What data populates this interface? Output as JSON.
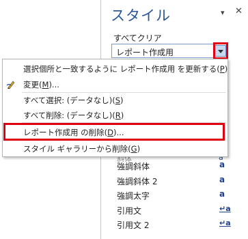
{
  "pane": {
    "title": "スタイル",
    "options_glyph": "▾",
    "close_glyph": "✕",
    "clear_all": "すべてクリア",
    "style_box_value": "レポート作成用"
  },
  "context_menu": {
    "items": [
      {
        "label": "選択個所と一致するように レポート作成用 を更新する(",
        "key": "P",
        "suffix": ")"
      },
      {
        "label": "変更(",
        "key": "M",
        "suffix": ")..."
      },
      {
        "label": "すべて選択: (データなし)(",
        "key": "S",
        "suffix": ")"
      },
      {
        "label": "すべて削除: (データなし)(",
        "key": "R",
        "suffix": ")"
      },
      {
        "label": "レポート作成用 の削除(",
        "key": "D",
        "suffix": ")..."
      },
      {
        "label": "スタイル ギャラリーから削除(",
        "key": "G",
        "suffix": ")"
      }
    ]
  },
  "styles_list": {
    "cutoff_text": "斜体",
    "cutoff_glyph": "a",
    "items": [
      {
        "name": "強調斜体",
        "glyph": "a",
        "type": "char"
      },
      {
        "name": "強調斜体 2",
        "glyph": "a",
        "type": "char"
      },
      {
        "name": "強調太字",
        "glyph": "a",
        "type": "char"
      },
      {
        "name": "引用文",
        "glyph": "↵a",
        "type": "para"
      },
      {
        "name": "引用文 2",
        "glyph": "↵a",
        "type": "para"
      }
    ]
  },
  "colors": {
    "title_blue": "#2b5797",
    "highlight_red": "#e00012",
    "glyph_blue": "#1f3f8f"
  }
}
